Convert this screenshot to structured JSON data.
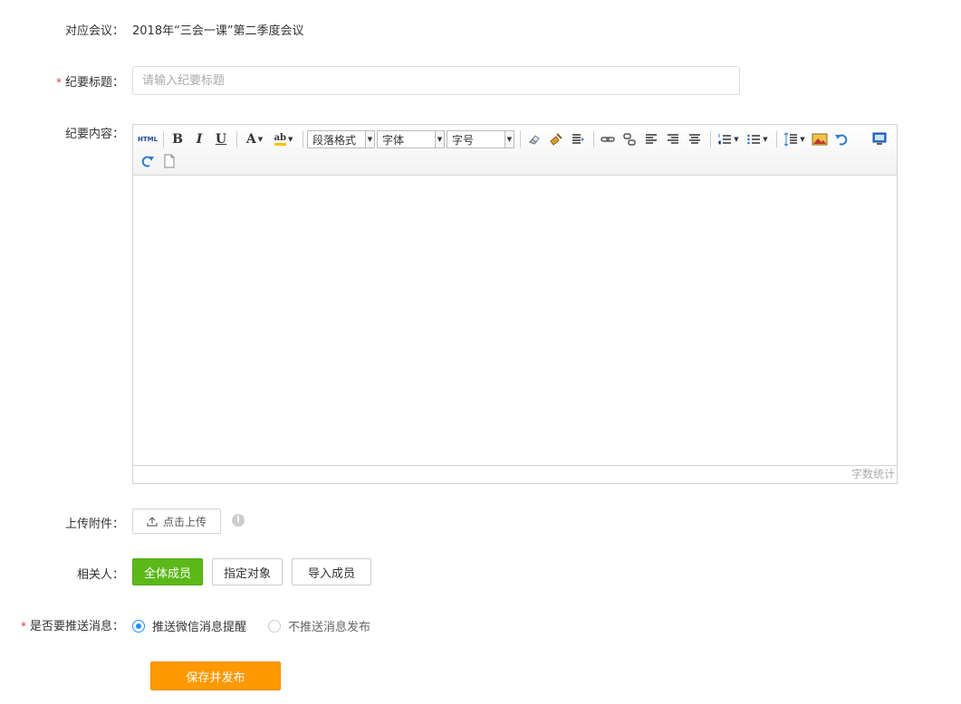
{
  "meeting": {
    "label": "对应会议：",
    "value": "2018年“三会一课”第二季度会议"
  },
  "title": {
    "required_mark": "*",
    "label": "纪要标题：",
    "placeholder": "请输入纪要标题",
    "value": ""
  },
  "content": {
    "label": "纪要内容：",
    "toolbar": {
      "html_label": "HTML",
      "bold": "B",
      "italic": "I",
      "underline": "U",
      "font_color": "A",
      "highlight": "ab",
      "paragraph_format": "段落格式",
      "font_family": "字体",
      "font_size": "字号"
    },
    "footer": "字数统计"
  },
  "upload": {
    "label": "上传附件：",
    "button": "点击上传",
    "info_icon": "i"
  },
  "related": {
    "label": "相关人：",
    "options": [
      {
        "label": "全体成员",
        "active": true
      },
      {
        "label": "指定对象",
        "active": false
      },
      {
        "label": "导入成员",
        "active": false
      }
    ]
  },
  "push": {
    "required_mark": "*",
    "label": "是否要推送消息：",
    "options": [
      {
        "label": "推送微信消息提醒",
        "checked": true
      },
      {
        "label": "不推送消息发布",
        "checked": false
      }
    ]
  },
  "save": {
    "label": "保存并发布"
  },
  "colors": {
    "accent_green": "#5cb818",
    "save_orange": "#ff9900",
    "required_red": "#e4393c",
    "radio_blue": "#1e90ff"
  }
}
